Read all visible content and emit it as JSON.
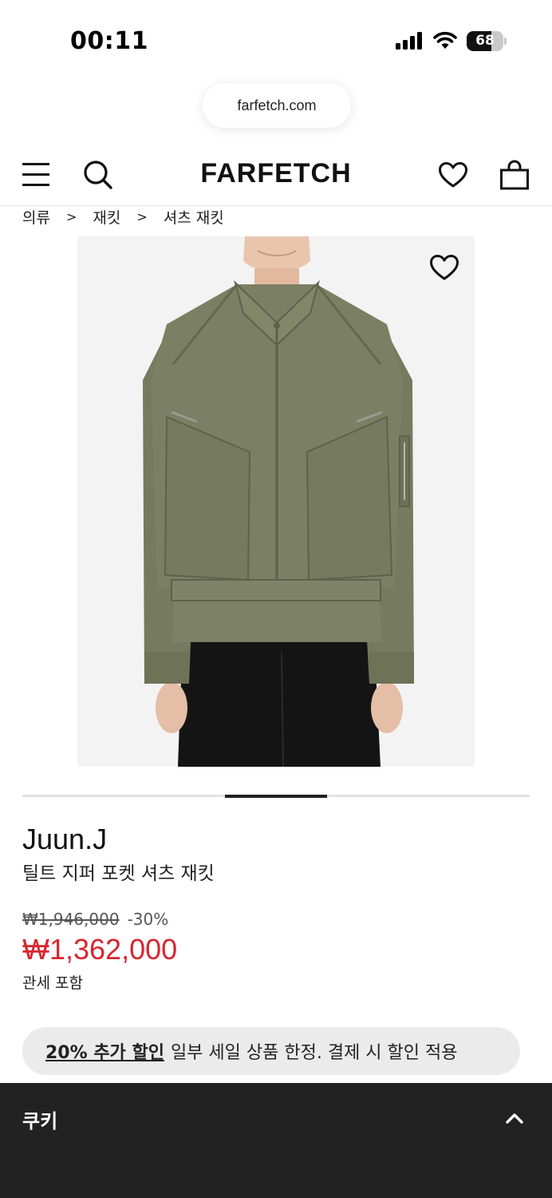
{
  "status_bar": {
    "time": "00:11",
    "battery_level": "68",
    "battery_fraction": 0.68
  },
  "browser": {
    "url": "farfetch.com"
  },
  "header": {
    "logo": "FARFETCH",
    "icons": [
      "menu-icon",
      "search-icon",
      "heart-icon",
      "shopping-bag-icon"
    ]
  },
  "breadcrumb": {
    "items": [
      "의류",
      "재킷",
      "셔츠 재킷"
    ],
    "separator": ">"
  },
  "gallery": {
    "image_label": "olive-green-shirt-jacket-photo",
    "active_slide_fraction": 0.2
  },
  "product": {
    "brand": "Juun.J",
    "name": "틸트 지퍼 포켓 셔츠 재킷",
    "original_price": "₩1,946,000",
    "discount": "-30%",
    "sale_price": "₩1,362,000",
    "duty_note": "관세 포함"
  },
  "promo": {
    "link_text": "20% 추가 할인",
    "text": "일부 세일 상품 한정. 결제 시 할인 적용"
  },
  "cookie": {
    "title": "쿠키"
  },
  "colors": {
    "sale_red": "#d6262f",
    "cookie_bg": "#222222",
    "promo_bg": "#ebebeb",
    "jacket_olive": "#7b7f63"
  }
}
